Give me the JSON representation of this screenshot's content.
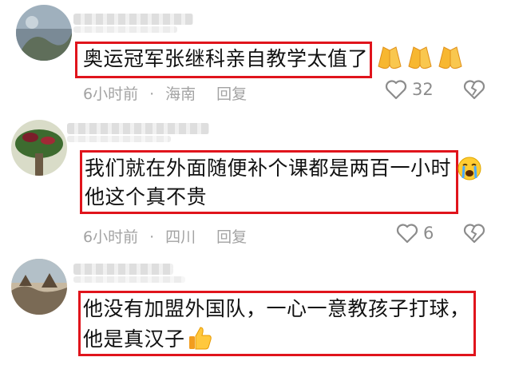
{
  "comments": [
    {
      "text_lines": [
        "奥运冠军张继科亲自教学太值了"
      ],
      "emoji": "praying-hands-x3",
      "time": "6小时前",
      "location": "海南",
      "reply": "回复",
      "likes": "32"
    },
    {
      "text_lines": [
        "我们就在外面随便补个课都是两百一小时",
        "他这个真不贵"
      ],
      "emoji": "crying-face",
      "time": "6小时前",
      "location": "四川",
      "reply": "回复",
      "likes": "6"
    },
    {
      "text_lines": [
        "他没有加盟外国队，一心一意教孩子打球，",
        "他是真汉子"
      ],
      "emoji": "thumbs-up",
      "time": "",
      "location": "",
      "reply": "",
      "likes": ""
    }
  ],
  "meta_separator": "·",
  "colors": {
    "highlight_border": "#e0141c",
    "meta_text": "#a3a3a3"
  }
}
